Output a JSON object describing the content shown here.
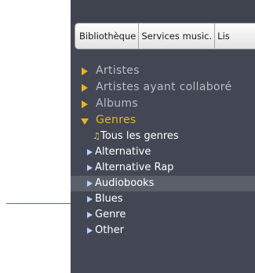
{
  "tabs": [
    "Bibliothèque",
    "Services music.",
    "Lis"
  ],
  "categories": [
    {
      "label": "Artistes",
      "expanded": false
    },
    {
      "label": "Artistes ayant collaboré",
      "expanded": false
    },
    {
      "label": "Albums",
      "expanded": false
    },
    {
      "label": "Genres",
      "expanded": true
    }
  ],
  "genres": {
    "all_label": "Tous les genres",
    "all_icon": "music-note-icon",
    "items": [
      "Alternative",
      "Alternative Rap",
      "Audiobooks",
      "Blues",
      "Genre",
      "Other"
    ],
    "selected": "Audiobooks"
  },
  "colors": {
    "panel": "#424753",
    "category_text": "#b9bcc4",
    "accent": "#e9b322",
    "sub_arrow": "#b8d2ff",
    "pointer_line": "#b34a4a"
  }
}
